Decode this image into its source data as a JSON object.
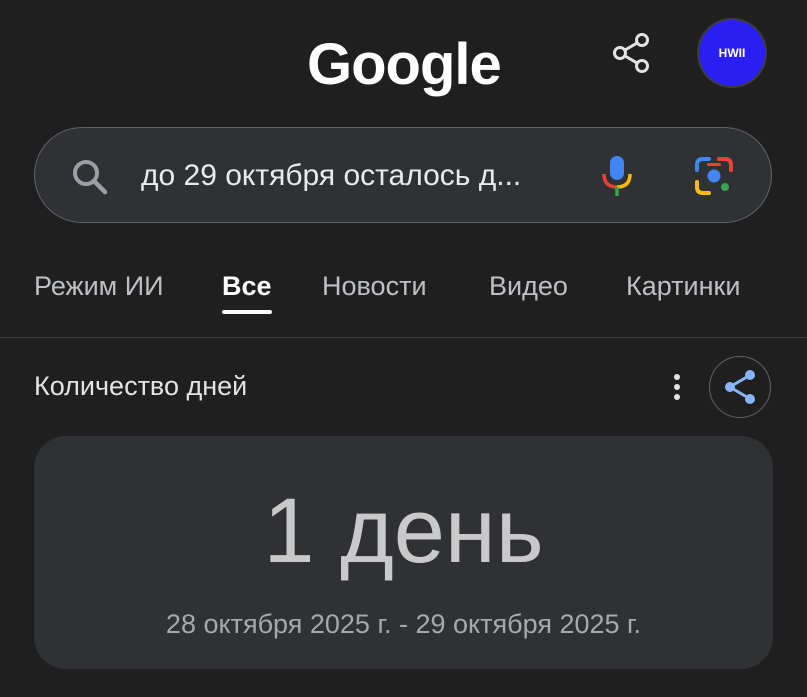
{
  "header": {
    "logo_text": "Google",
    "avatar_text": "HWII",
    "avatar_color": "#2a1ff2"
  },
  "search": {
    "query": "до 29 октября осталось д..."
  },
  "tabs": [
    {
      "label": "Режим ИИ",
      "active": false
    },
    {
      "label": "Все",
      "active": true
    },
    {
      "label": "Новости",
      "active": false
    },
    {
      "label": "Видео",
      "active": false
    },
    {
      "label": "Картинки",
      "active": false
    }
  ],
  "result": {
    "title": "Количество дней",
    "value": "1 день",
    "range": "28 октября 2025 г. - 29 октября 2025 г."
  },
  "icons": {
    "header_share": "share-icon",
    "search": "search-icon",
    "mic": "mic-icon",
    "lens": "lens-icon",
    "more": "more-vert-icon",
    "result_share": "share-icon"
  },
  "colors": {
    "background": "#1f1f1f",
    "surface": "#303134",
    "accent_blue": "#8ab4f8"
  }
}
